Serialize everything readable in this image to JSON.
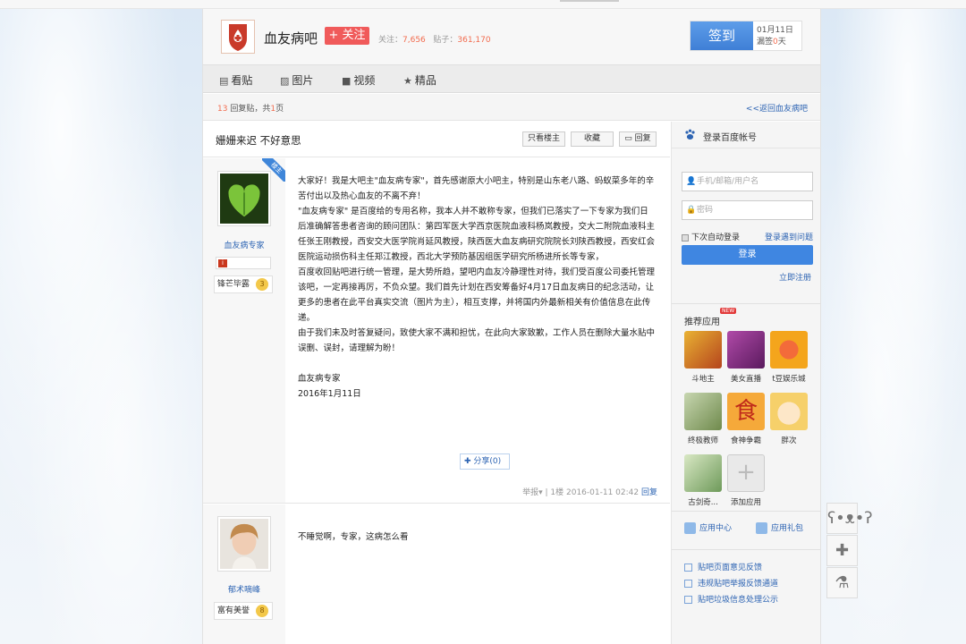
{
  "colors": {
    "accent": "#3f86e1",
    "brand_red": "#f05a5a",
    "link": "#2d64b3",
    "number": "#f26c4f"
  },
  "forum": {
    "name": "血友病吧",
    "follow_label": "+ 关注",
    "followers_label": "关注：",
    "followers": "7,656",
    "posts_label": "贴子：",
    "posts": "361,170"
  },
  "signin": {
    "button": "签到",
    "date": "01月11日",
    "streak_prefix": "漏签",
    "streak_value": "0",
    "streak_suffix": "天"
  },
  "nav": [
    {
      "icon": "document-icon",
      "label": "看贴"
    },
    {
      "icon": "image-icon",
      "label": "图片"
    },
    {
      "icon": "video-icon",
      "label": "视频"
    },
    {
      "icon": "star-icon",
      "label": "精品"
    }
  ],
  "page_info": {
    "reply_count": "13",
    "reply_text": "回复贴，共",
    "page_count": "1",
    "page_suffix": "页",
    "back_link": "<<返回血友病吧"
  },
  "thread": {
    "title": "姗姗来迟 不好意思",
    "only_owner": "只看楼主",
    "collect": "收藏",
    "reply": "回复"
  },
  "posts": [
    {
      "username": "血友病专家",
      "badge_label": "锋芒毕露",
      "badge_level": "3",
      "corner_tag": "楼主",
      "level_tag": "i",
      "paragraphs": [
        "大家好！我是大吧主\"血友病专家\"，首先感谢原大小吧主，特别是山东老八路、蚂蚁菜多年的辛苦付出以及热心血友的不离不弃！",
        "\"血友病专家\" 是百度给的专用名称，我本人并不敢称专家，但我们已落实了一下专家为我们日后准确解答患者咨询的顾问团队：第四军医大学西京医院血液科杨岚教授，交大二附院血液科主任张王刚教授，西安交大医学院肖延风教授，陕西医大血友病研究院院长刘陕西教授，西安红会医院运动损伤科主任郑江教授，西北大学预防基因组医学研究所杨进所长等专家，",
        "百度收回贴吧进行统一管理，是大势所趋，望吧内血友冷静理性对待，我们受百度公司委托管理该吧，一定再接再厉，不负众望。我们首先计划在西安筹备好4月17日血友病日的纪念活动，让更多的患者在此平台真实交流（图片为主），相互支撑，并将国内外最新相关有价值信息在此传递。",
        "由于我们未及时答复疑问，致使大家不满和担忧，在此向大家致歉，工作人员在删除大量水贴中误删、误封，请理解为盼！",
        "",
        "血友病专家",
        "2016年1月11日"
      ],
      "share_label": "分享(0)",
      "report": "举报",
      "floor": "1楼",
      "time": "2016-01-11 02:42",
      "reply": "回复"
    },
    {
      "username": "郁术嘀峰",
      "badge_label": "富有美誉",
      "badge_level": "8",
      "paragraphs": [
        "不睡觉啊，专家，这病怎么看"
      ]
    }
  ],
  "login": {
    "title": "登录百度帐号",
    "username_placeholder": "手机/邮箱/用户名",
    "password_placeholder": "密码",
    "auto_login": "下次自动登录",
    "problem": "登录遇到问题",
    "button": "登录",
    "register": "立即注册"
  },
  "apps": {
    "title": "推荐应用",
    "new_tag": "NEW",
    "items": [
      {
        "label": "斗地主",
        "color": "#d8a030"
      },
      {
        "label": "美女直播",
        "color": "#8a2e8a"
      },
      {
        "label": "t豆娱乐城",
        "color": "#f0a020"
      },
      {
        "label": "终极教师",
        "color": "#8aa46a"
      },
      {
        "label": "食神争霸",
        "color": "#f5b03a"
      },
      {
        "label": "胖次",
        "color": "#f6d56a"
      },
      {
        "label": "古剑奇...",
        "color": "#9cc08a"
      },
      {
        "label": "添加应用",
        "color": "#e9e9e9"
      }
    ],
    "center": "应用中心",
    "gift": "应用礼包"
  },
  "feedback": [
    "贴吧页面意见反馈",
    "违规贴吧举报反馈通道",
    "贴吧垃圾信息处理公示"
  ],
  "tools": [
    "bear-icon",
    "plus-icon",
    "flask-icon"
  ]
}
